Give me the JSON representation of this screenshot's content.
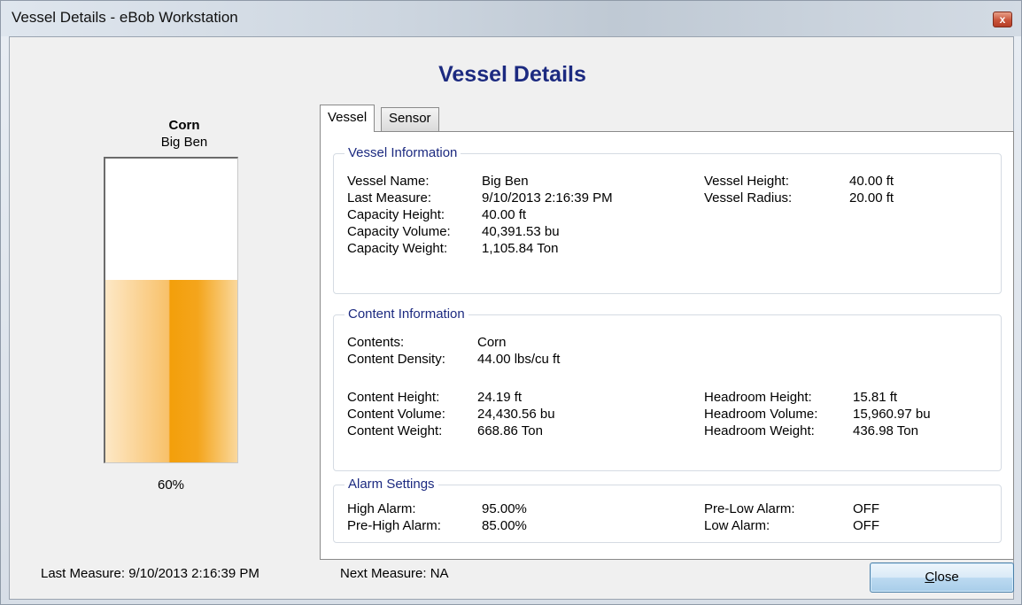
{
  "window": {
    "title": "Vessel Details - eBob Workstation",
    "close_glyph": "x"
  },
  "heading": "Vessel Details",
  "vessel_card": {
    "content": "Corn",
    "name": "Big Ben",
    "fill_fraction": 0.6,
    "fill_label": "60%"
  },
  "tabs": [
    {
      "label": "Vessel",
      "active": true
    },
    {
      "label": "Sensor",
      "active": false
    }
  ],
  "vessel_info": {
    "title": "Vessel Information",
    "left": [
      {
        "label": "Vessel Name:",
        "value": "Big Ben"
      },
      {
        "label": "Last Measure:",
        "value": "9/10/2013 2:16:39 PM"
      },
      {
        "label": "Capacity Height:",
        "value": "40.00 ft"
      },
      {
        "label": "Capacity Volume:",
        "value": "40,391.53 bu"
      },
      {
        "label": "Capacity Weight:",
        "value": "1,105.84 Ton"
      }
    ],
    "right": [
      {
        "label": "Vessel Height:",
        "value": "40.00 ft"
      },
      {
        "label": "Vessel Radius:",
        "value": "20.00 ft"
      }
    ]
  },
  "content_info": {
    "title": "Content Information",
    "top": [
      {
        "label": "Contents:",
        "value": "Corn"
      },
      {
        "label": "Content Density:",
        "value": "44.00 lbs/cu ft"
      }
    ],
    "left": [
      {
        "label": "Content Height:",
        "value": "24.19 ft"
      },
      {
        "label": "Content Volume:",
        "value": "24,430.56 bu"
      },
      {
        "label": "Content Weight:",
        "value": "668.86 Ton"
      }
    ],
    "right": [
      {
        "label": "Headroom Height:",
        "value": "15.81 ft"
      },
      {
        "label": "Headroom Volume:",
        "value": "15,960.97 bu"
      },
      {
        "label": "Headroom Weight:",
        "value": "436.98 Ton"
      }
    ]
  },
  "alarm_settings": {
    "title": "Alarm Settings",
    "left": [
      {
        "label": "High Alarm:",
        "value": "95.00%"
      },
      {
        "label": "Pre-High Alarm:",
        "value": "85.00%"
      }
    ],
    "right": [
      {
        "label": "Pre-Low Alarm:",
        "value": "OFF"
      },
      {
        "label": "Low Alarm:",
        "value": "OFF"
      }
    ]
  },
  "status": {
    "last_measure": "Last Measure: 9/10/2013 2:16:39 PM",
    "next_measure": "Next Measure: NA"
  },
  "close_button": {
    "label": "Close"
  },
  "colors": {
    "heading": "#1c2a80",
    "fill": "#f39f0a",
    "group_title": "#1c2a80"
  }
}
